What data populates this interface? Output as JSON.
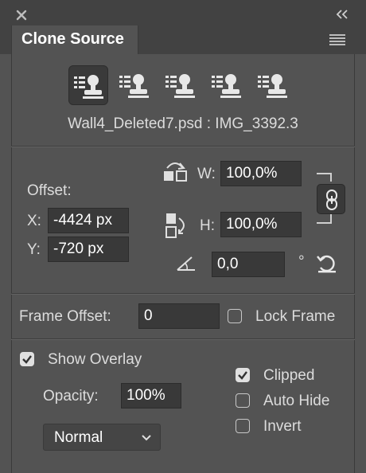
{
  "panel": {
    "title": "Clone Source",
    "collapse_glyph": "‹‹"
  },
  "sources": [
    {
      "icon": "clone-source-stamp-icon",
      "selected": true
    },
    {
      "icon": "clone-source-stamp-icon",
      "selected": false
    },
    {
      "icon": "clone-source-stamp-icon",
      "selected": false
    },
    {
      "icon": "clone-source-stamp-icon",
      "selected": false
    },
    {
      "icon": "clone-source-stamp-icon",
      "selected": false
    }
  ],
  "source_name": "Wall4_Deleted7.psd : IMG_3392.3",
  "offset": {
    "label": "Offset:",
    "x_label": "X:",
    "x_value": "-4424 px",
    "y_label": "Y:",
    "y_value": "-720 px"
  },
  "scale": {
    "w_label": "W:",
    "w_value": "100,0%",
    "h_label": "H:",
    "h_value": "100,0%",
    "link_icon": "link-chain-icon"
  },
  "rotation": {
    "value": "0,0",
    "unit": "°",
    "reset_icon": "reset-rotation-icon"
  },
  "frame": {
    "label": "Frame Offset:",
    "value": "0",
    "lock_label": "Lock Frame",
    "lock_checked": false
  },
  "overlay": {
    "show_label": "Show Overlay",
    "show_checked": true,
    "opacity_label": "Opacity:",
    "opacity_value": "100%",
    "blend_mode": "Normal",
    "clipped_label": "Clipped",
    "clipped_checked": true,
    "autohide_label": "Auto Hide",
    "autohide_checked": false,
    "invert_label": "Invert",
    "invert_checked": false
  }
}
